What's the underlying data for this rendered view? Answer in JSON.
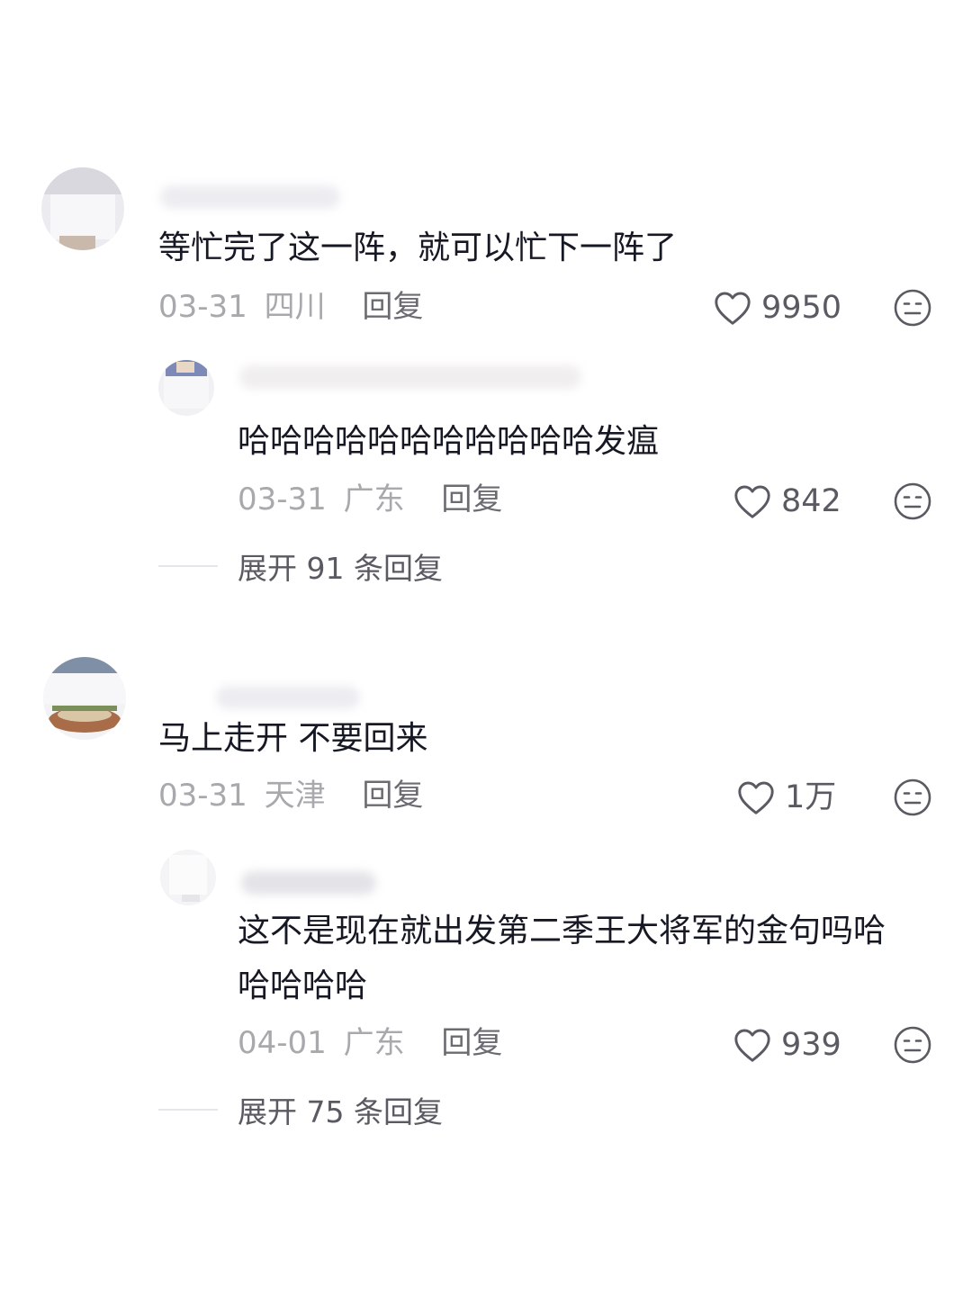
{
  "comments": [
    {
      "text": "等忙完了这一阵，就可以忙下一阵了",
      "date": "03-31",
      "location": "四川",
      "reply_label": "回复",
      "likes": "9950",
      "reply": {
        "text": "哈哈哈哈哈哈哈哈哈哈哈发瘟",
        "date": "03-31",
        "location": "广东",
        "reply_label": "回复",
        "likes": "842"
      },
      "expand_label": "展开 91 条回复"
    },
    {
      "text": "马上走开 不要回来",
      "date": "03-31",
      "location": "天津",
      "reply_label": "回复",
      "likes": "1万",
      "reply": {
        "text_line1": "这不是现在就出发第二季王大将军的金句吗哈",
        "text_line2": "哈哈哈哈",
        "date": "04-01",
        "location": "广东",
        "reply_label": "回复",
        "likes": "939"
      },
      "expand_label": "展开 75 条回复"
    }
  ],
  "icons": {
    "like": "heart-outline-icon",
    "dislike": "meh-face-icon"
  },
  "colors": {
    "text": "#161823",
    "meta": "#a8a8ad",
    "icon": "#5a5a62"
  }
}
